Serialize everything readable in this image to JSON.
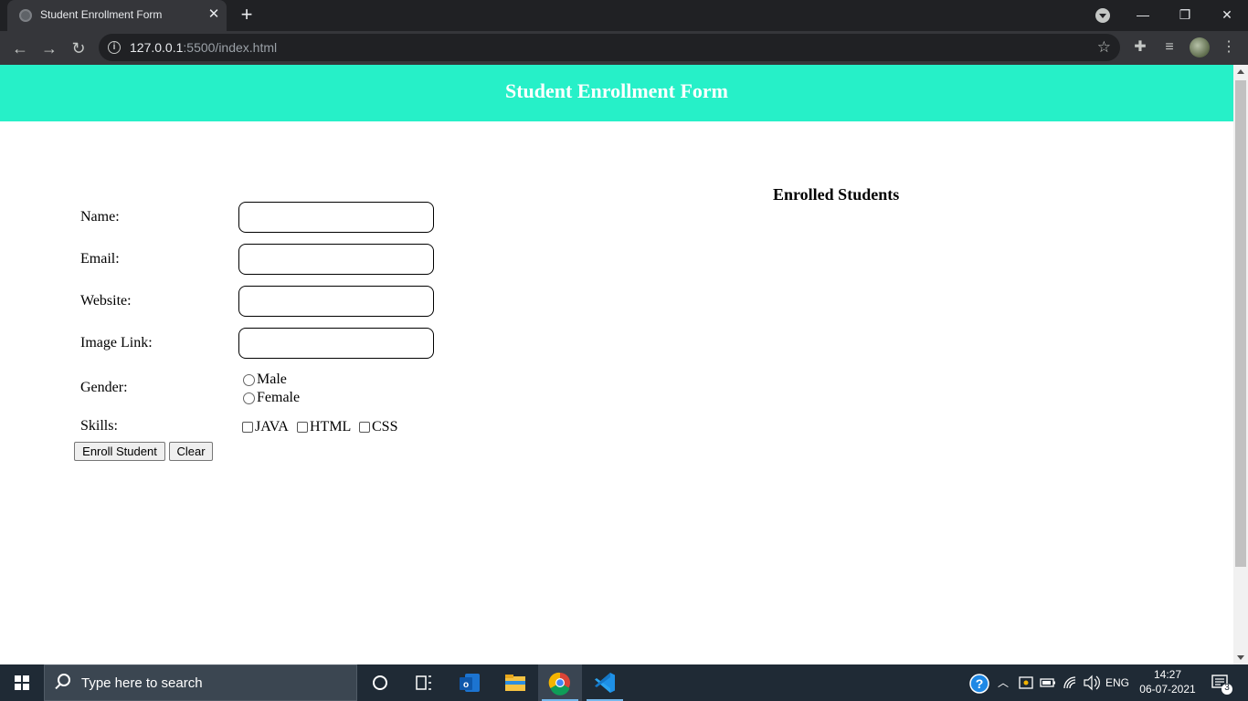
{
  "browser": {
    "tab_title": "Student Enrollment Form",
    "tab_close": "✕",
    "new_tab": "+",
    "url_host": "127.0.0.1",
    "url_rest": ":5500/index.html",
    "window_minimize": "—",
    "window_restore": "❐",
    "window_close": "✕"
  },
  "page": {
    "header_title": "Student Enrollment Form",
    "enrolled_title": "Enrolled Students"
  },
  "form": {
    "name_label": "Name:",
    "email_label": "Email:",
    "website_label": "Website:",
    "image_link_label": "Image Link:",
    "gender_label": "Gender:",
    "gender_options": [
      "Male",
      "Female"
    ],
    "skills_label": "Skills:",
    "skills_options": [
      "JAVA",
      "HTML",
      "CSS"
    ],
    "enroll_button": "Enroll Student",
    "clear_button": "Clear",
    "name_value": "",
    "email_value": "",
    "website_value": "",
    "image_link_value": ""
  },
  "taskbar": {
    "search_placeholder": "Type here to search",
    "language": "ENG",
    "time": "14:27",
    "date": "06-07-2021",
    "notification_count": "3"
  },
  "colors": {
    "header_bg": "#26f0c8",
    "chrome_dark": "#202124",
    "taskbar_bg": "#1f2a35"
  },
  "icons": [
    "globe-icon",
    "back-arrow-icon",
    "forward-arrow-icon",
    "reload-icon",
    "info-icon",
    "star-icon",
    "extensions-icon",
    "media-icon",
    "menu-dots-icon",
    "windows-logo-icon",
    "search-icon",
    "cortana-icon",
    "task-view-icon",
    "outlook-icon",
    "file-explorer-icon",
    "chrome-icon",
    "vscode-icon",
    "help-icon",
    "chevron-up-icon",
    "battery-icon",
    "wifi-icon",
    "volume-icon",
    "notification-icon"
  ]
}
